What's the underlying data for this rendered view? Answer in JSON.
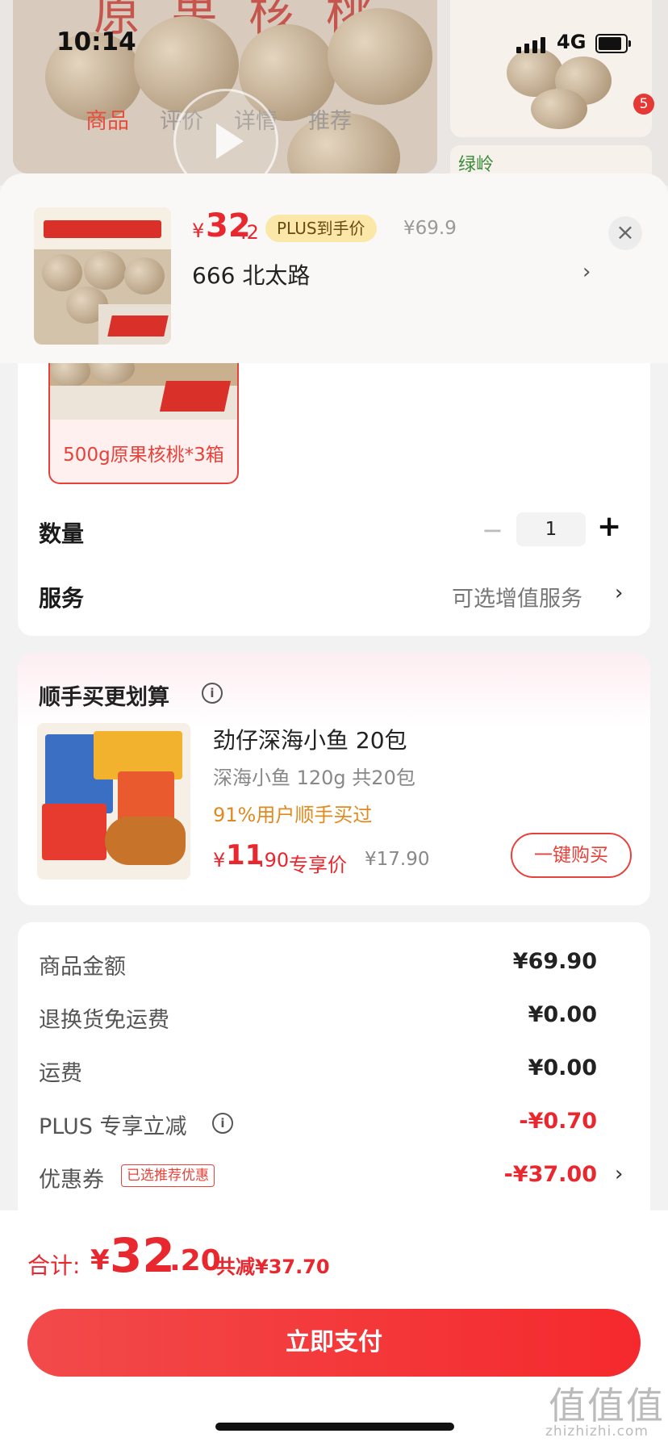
{
  "status": {
    "time": "10:14",
    "network": "4G"
  },
  "background": {
    "tabs": [
      "商品",
      "评价",
      "详情",
      "推荐"
    ],
    "hero_title": "原果核桃",
    "side_badge": "5",
    "side_brand": "绿岭"
  },
  "sheet": {
    "price_symbol": "¥",
    "price_int": "32",
    "price_dec": ".2",
    "plus_tag": "PLUS到手价",
    "original_price": "¥69.9",
    "close": "×",
    "address": "666 北太路",
    "spec_label": "500g原果核桃*3箱",
    "qty_label": "数量",
    "qty_value": "1",
    "qty_minus": "−",
    "qty_plus": "+",
    "service_label": "服务",
    "service_value": "可选增值服务"
  },
  "bundle": {
    "title": "顺手买更划算",
    "product_name": "劲仔深海小鱼 20包",
    "product_spec": "深海小鱼 120g 共20包",
    "buy_note": "91%用户顺手买过",
    "price_symbol": "¥",
    "price_int": "11",
    "price_dec": ".90",
    "exclusive": "专享价",
    "original_price": "¥17.90",
    "buy_button": "一键购买"
  },
  "summary": {
    "rows": [
      {
        "label": "商品金额",
        "value": "¥69.90"
      },
      {
        "label": "退换货免运费",
        "value": "¥0.00"
      },
      {
        "label": "运费",
        "value": "¥0.00"
      },
      {
        "label": "PLUS 专享立减",
        "value": "-¥0.70"
      },
      {
        "label": "优惠券",
        "value": "-¥37.00"
      }
    ],
    "coupon_tag": "已选推荐优惠"
  },
  "footer": {
    "total_label": "合计:",
    "total_symbol": "¥",
    "total_int": "32",
    "total_dec": ".20",
    "total_saved": "共减¥37.70",
    "pay_button": "立即支付"
  },
  "watermark": {
    "main": "值值值",
    "sub": "zhizhizhi.com"
  },
  "colors": {
    "accent": "#e8272e",
    "plus_tag_bg": "#fbe7a8",
    "note": "#e08a1f"
  }
}
